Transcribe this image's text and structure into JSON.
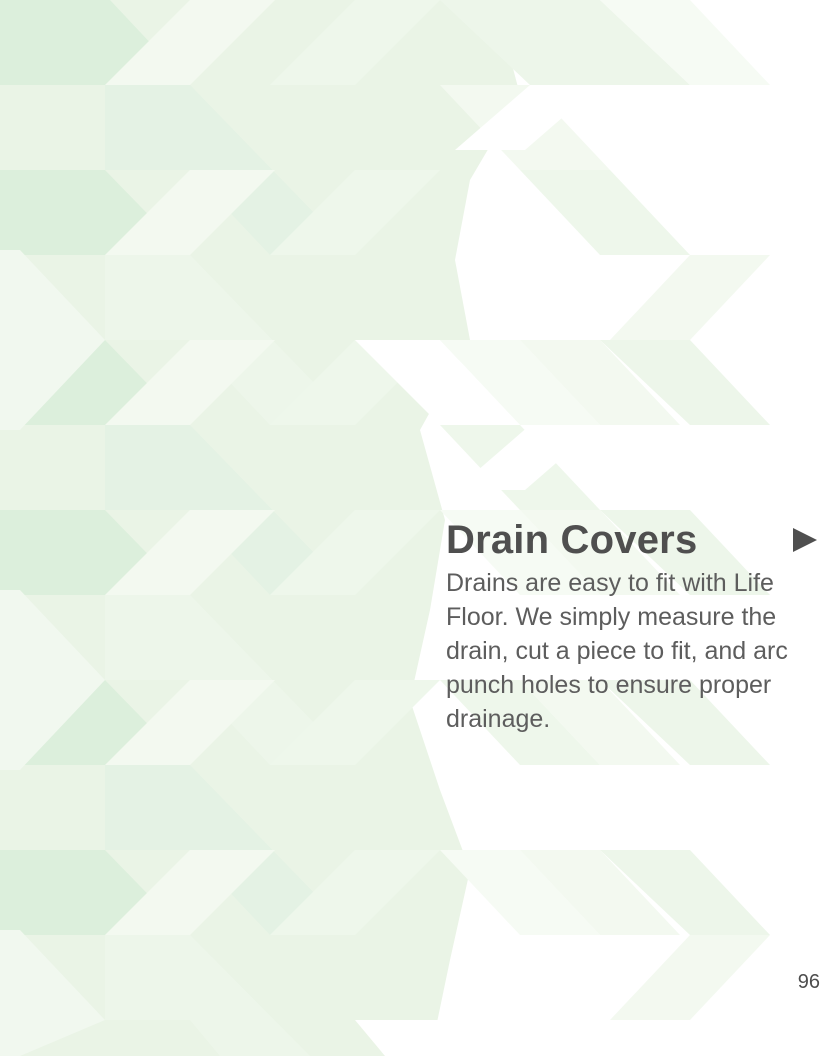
{
  "page": {
    "title": "Drain Covers",
    "body": "Drains are easy to fit with Life Floor. We simply measure the drain, cut a piece to fit, and arc punch holes to ensure proper drainage.",
    "page_number": "96"
  },
  "decorations": {
    "background_pattern": "green chevron geometric pattern",
    "arrow_icon": "play-triangle-icon"
  },
  "colors": {
    "background": "#ffffff",
    "pattern_dark": "#dcefdc",
    "pattern_mid": "#e4f2e4",
    "pattern_light": "#edf6ea",
    "text": "#5d5d5d",
    "title": "#4f4f4f"
  }
}
